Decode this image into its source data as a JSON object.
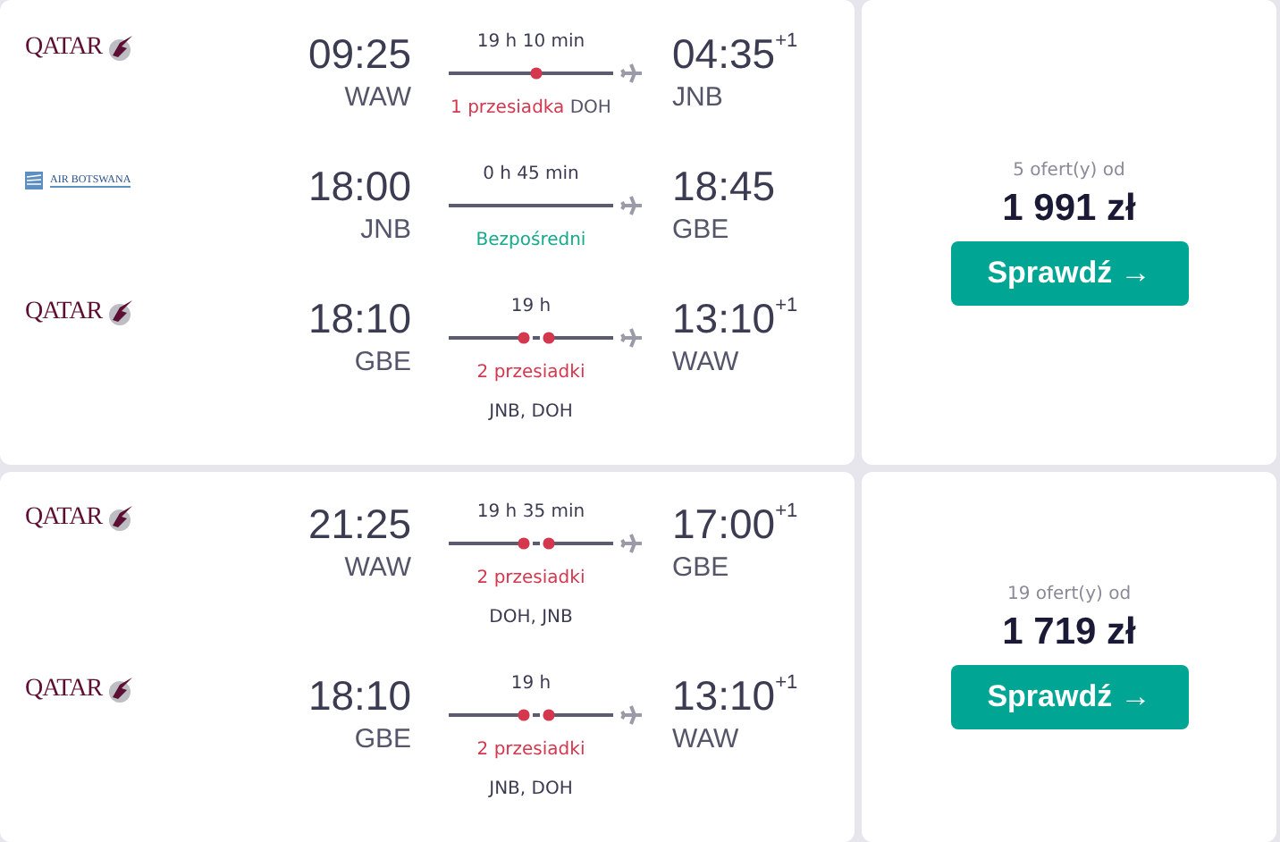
{
  "results": [
    {
      "segments": [
        {
          "airline": {
            "kind": "qatar",
            "name": "QATAR"
          },
          "dep_time": "09:25",
          "dep_airport": "WAW",
          "duration": "19 h 10 min",
          "kind": "one_stop",
          "stops_label": "1 przesiadka",
          "via": "DOH",
          "via_inline": true,
          "arr_time": "04:35",
          "next_day": "+1",
          "arr_airport": "JNB"
        },
        {
          "airline": {
            "kind": "botswana",
            "name": "AIR BOTSWANA"
          },
          "dep_time": "18:00",
          "dep_airport": "JNB",
          "duration": "0 h 45 min",
          "kind": "direct",
          "stops_label": "Bezpośredni",
          "arr_time": "18:45",
          "arr_airport": "GBE"
        },
        {
          "airline": {
            "kind": "qatar",
            "name": "QATAR"
          },
          "dep_time": "18:10",
          "dep_airport": "GBE",
          "duration": "19 h",
          "kind": "two_stops",
          "stops_label": "2 przesiadki",
          "via": "JNB, DOH",
          "via_inline": false,
          "arr_time": "13:10",
          "next_day": "+1",
          "arr_airport": "WAW"
        }
      ],
      "offers": "5 ofert(y) od",
      "price": "1 991 zł",
      "button": "Sprawdź →"
    },
    {
      "segments": [
        {
          "airline": {
            "kind": "qatar",
            "name": "QATAR"
          },
          "dep_time": "21:25",
          "dep_airport": "WAW",
          "duration": "19 h 35 min",
          "kind": "two_stops",
          "stops_label": "2 przesiadki",
          "via": "DOH, JNB",
          "via_inline": false,
          "arr_time": "17:00",
          "next_day": "+1",
          "arr_airport": "GBE"
        },
        {
          "airline": {
            "kind": "qatar",
            "name": "QATAR"
          },
          "dep_time": "18:10",
          "dep_airport": "GBE",
          "duration": "19 h",
          "kind": "two_stops",
          "stops_label": "2 przesiadki",
          "via": "JNB, DOH",
          "via_inline": false,
          "arr_time": "13:10",
          "next_day": "+1",
          "arr_airport": "WAW"
        }
      ],
      "offers": "19 ofert(y) od",
      "price": "1 719 zł",
      "button": "Sprawdź →"
    }
  ]
}
